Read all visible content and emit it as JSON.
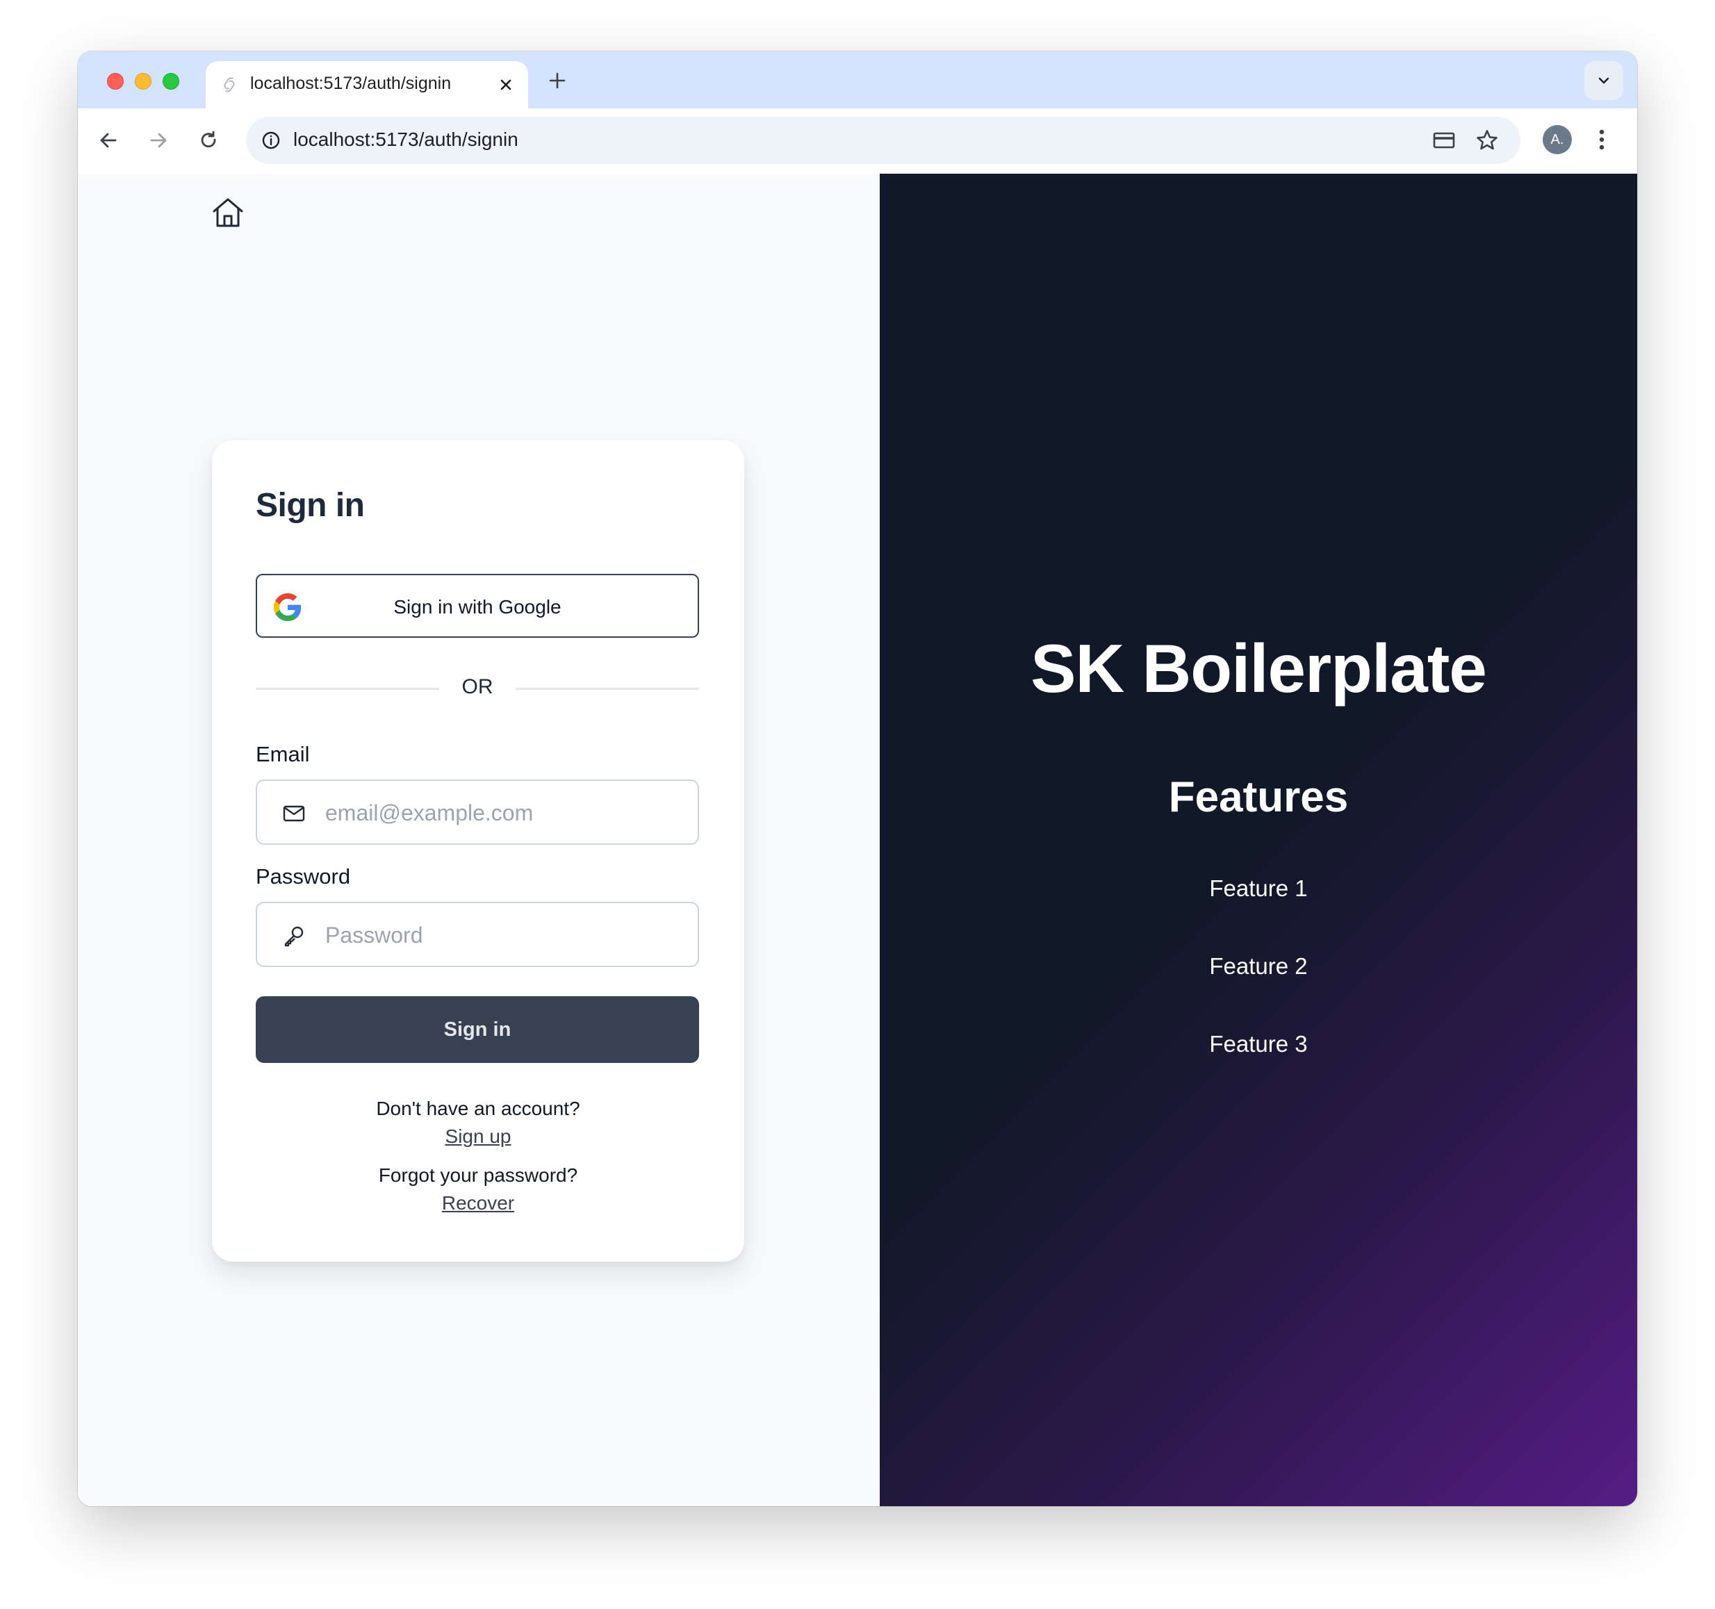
{
  "browser": {
    "tab_title": "localhost:5173/auth/signin",
    "url": "localhost:5173/auth/signin",
    "profile_initial": "A."
  },
  "signin": {
    "title": "Sign in",
    "google_button": "Sign in with Google",
    "divider": "OR",
    "email_label": "Email",
    "email_placeholder": "email@example.com",
    "password_label": "Password",
    "password_placeholder": "Password",
    "submit": "Sign in",
    "no_account": "Don't have an account?",
    "signup_link": "Sign up",
    "forgot": "Forgot your password?",
    "recover_link": "Recover"
  },
  "hero": {
    "brand": "SK Boilerplate",
    "features_title": "Features",
    "features": [
      "Feature 1",
      "Feature 2",
      "Feature 3"
    ]
  },
  "colors": {
    "tabstrip": "#d3e3fd",
    "submit_button": "#374151",
    "hero_dark": "#111827",
    "hero_purple": "#551c85"
  }
}
